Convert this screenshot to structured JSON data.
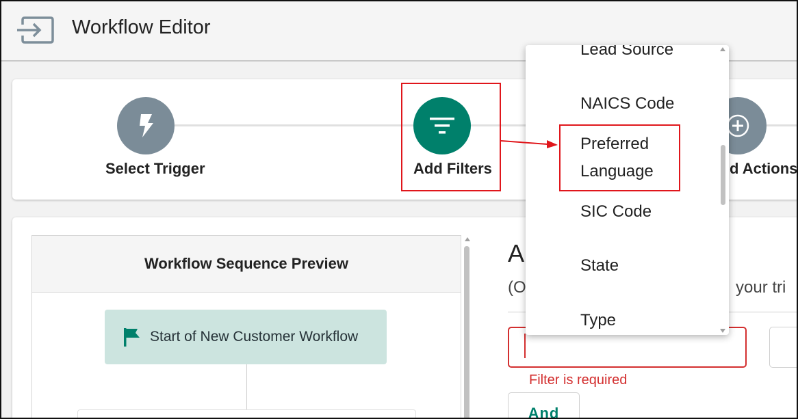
{
  "header": {
    "title": "Workflow Editor",
    "exit_icon": "exit-to-app-icon"
  },
  "stepper": {
    "steps": [
      {
        "label": "Select Trigger",
        "icon": "bolt-icon",
        "color": "#7b8c98"
      },
      {
        "label": "Add Filters",
        "icon": "filter-icon",
        "color": "#00806b"
      },
      {
        "label": "d Actions",
        "icon": "plus-icon",
        "color": "#7b8c98"
      }
    ]
  },
  "preview": {
    "title": "Workflow Sequence Preview",
    "start_node": {
      "label": "Start of New Customer Workflow",
      "icon": "flag-icon"
    }
  },
  "filters_panel": {
    "heading": "A",
    "subtext_left": "(O",
    "subtext_right": "your tri",
    "filter_error": "Filter is required",
    "and_button": "And"
  },
  "dropdown": {
    "options": [
      "Lead Source",
      "NAICS Code",
      "Preferred",
      "Language",
      "SIC Code",
      "State",
      "Type"
    ],
    "highlighted": "Preferred Language"
  },
  "colors": {
    "accent": "#00806b",
    "error": "#d32f2f",
    "annotation": "#e0161b"
  }
}
